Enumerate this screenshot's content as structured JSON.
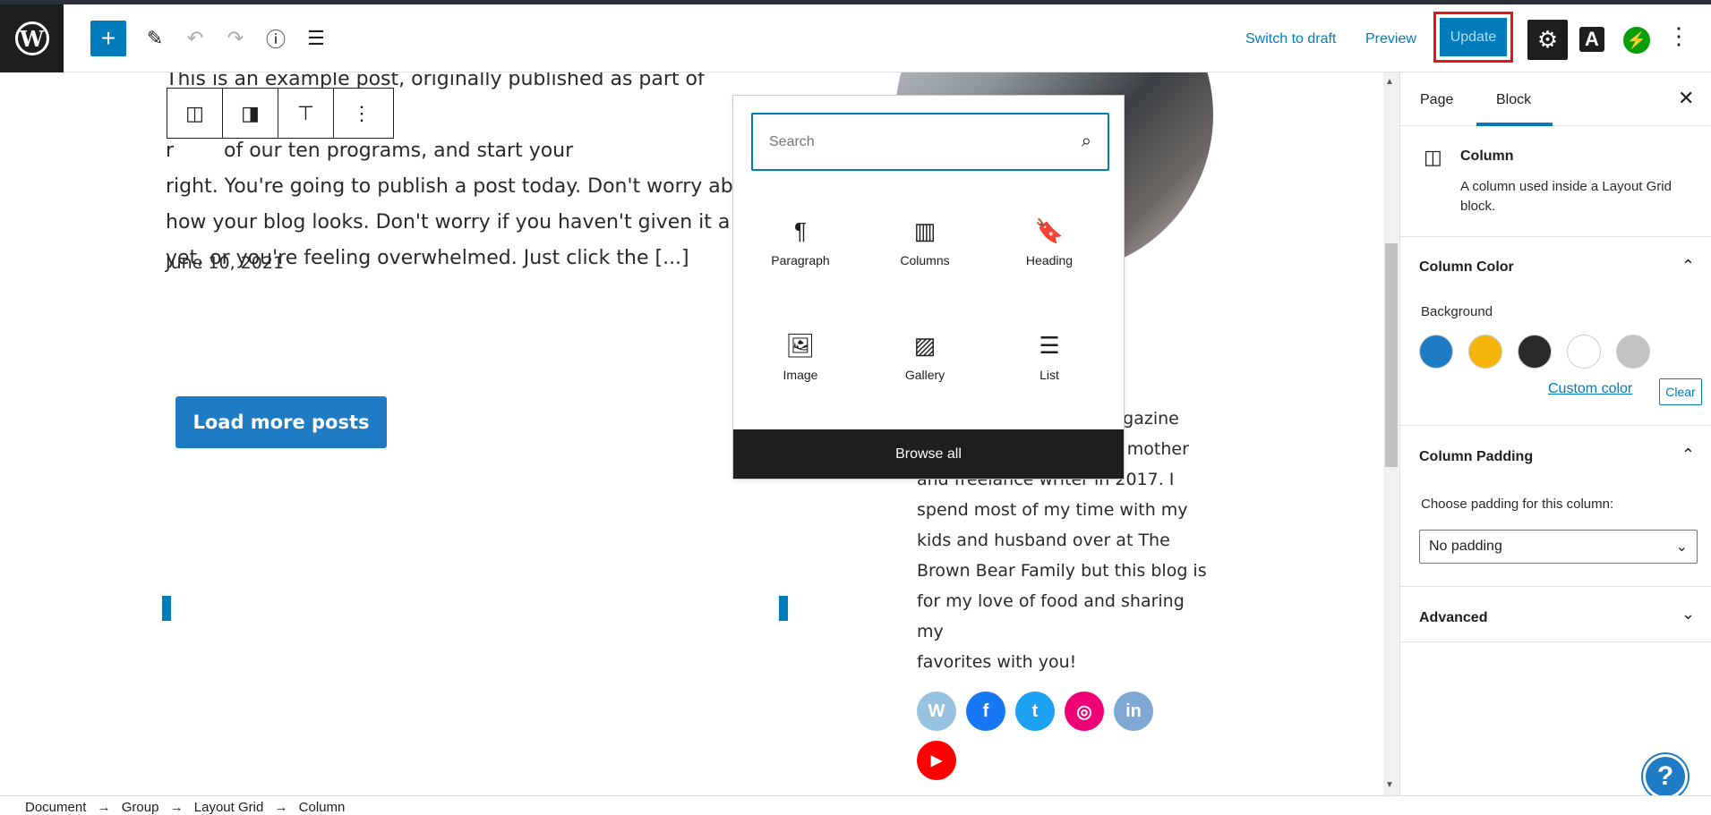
{
  "toolbar": {
    "switch_to_draft": "Switch to draft",
    "preview": "Preview",
    "update": "Update",
    "font_icon_letter": "A",
    "wp_letter": "W"
  },
  "post": {
    "excerpt_lines": [
      "This is an example post, originally published as part of Blogging",
      "r        of our ten programs, and start your",
      "right. You're going to publish a post today. Don't worry about",
      "how your blog looks. Don't worry if you haven't given it a na",
      "yet, or you're feeling overwhelmed. Just click the [...]"
    ],
    "date": "June 10, 2021",
    "load_more": "Load more posts"
  },
  "bio": {
    "lines": [
      "magazine",
      "he mother",
      "and freelance writer in 2017. I",
      "spend most of my time with my",
      "kids and husband over at The",
      "Brown Bear Family but this blog is",
      "for my love of food and sharing my",
      "favorites with you!"
    ]
  },
  "social": [
    {
      "name": "wordpress",
      "glyph": "W",
      "color": "#97c3e0"
    },
    {
      "name": "facebook",
      "glyph": "f",
      "color": "#1877f2"
    },
    {
      "name": "twitter",
      "glyph": "t",
      "color": "#1da1f2"
    },
    {
      "name": "instagram",
      "glyph": "◎",
      "color": "#f00075"
    },
    {
      "name": "linkedin",
      "glyph": "in",
      "color": "#7fa9d4"
    },
    {
      "name": "youtube",
      "glyph": "▶",
      "color": "#ff0000"
    }
  ],
  "inserter": {
    "search_placeholder": "Search",
    "blocks": [
      {
        "label": "Paragraph",
        "icon": "¶"
      },
      {
        "label": "Columns",
        "icon": "▥"
      },
      {
        "label": "Heading",
        "icon": "🔖"
      },
      {
        "label": "Image",
        "icon": "🖼"
      },
      {
        "label": "Gallery",
        "icon": "▨"
      },
      {
        "label": "List",
        "icon": "☰"
      }
    ],
    "browse_all": "Browse all"
  },
  "sidebar": {
    "tabs": [
      "Page",
      "Block"
    ],
    "active_tab": "Block",
    "block": {
      "name": "Column",
      "description": "A column used inside a Layout Grid block."
    },
    "column_color": {
      "title": "Column Color",
      "background_label": "Background",
      "swatches": [
        "#1e7bc4",
        "#f5b50c",
        "#2a2a2a",
        "#ffffff",
        "#c2c2c2"
      ],
      "custom_color": "Custom color",
      "clear": "Clear"
    },
    "column_padding": {
      "title": "Column Padding",
      "choose_label": "Choose padding for this column:",
      "selected": "No padding"
    },
    "advanced": {
      "title": "Advanced"
    }
  },
  "breadcrumbs": [
    "Document",
    "→",
    "Group",
    "→",
    "Layout Grid",
    "→",
    "Column"
  ],
  "help": "?"
}
